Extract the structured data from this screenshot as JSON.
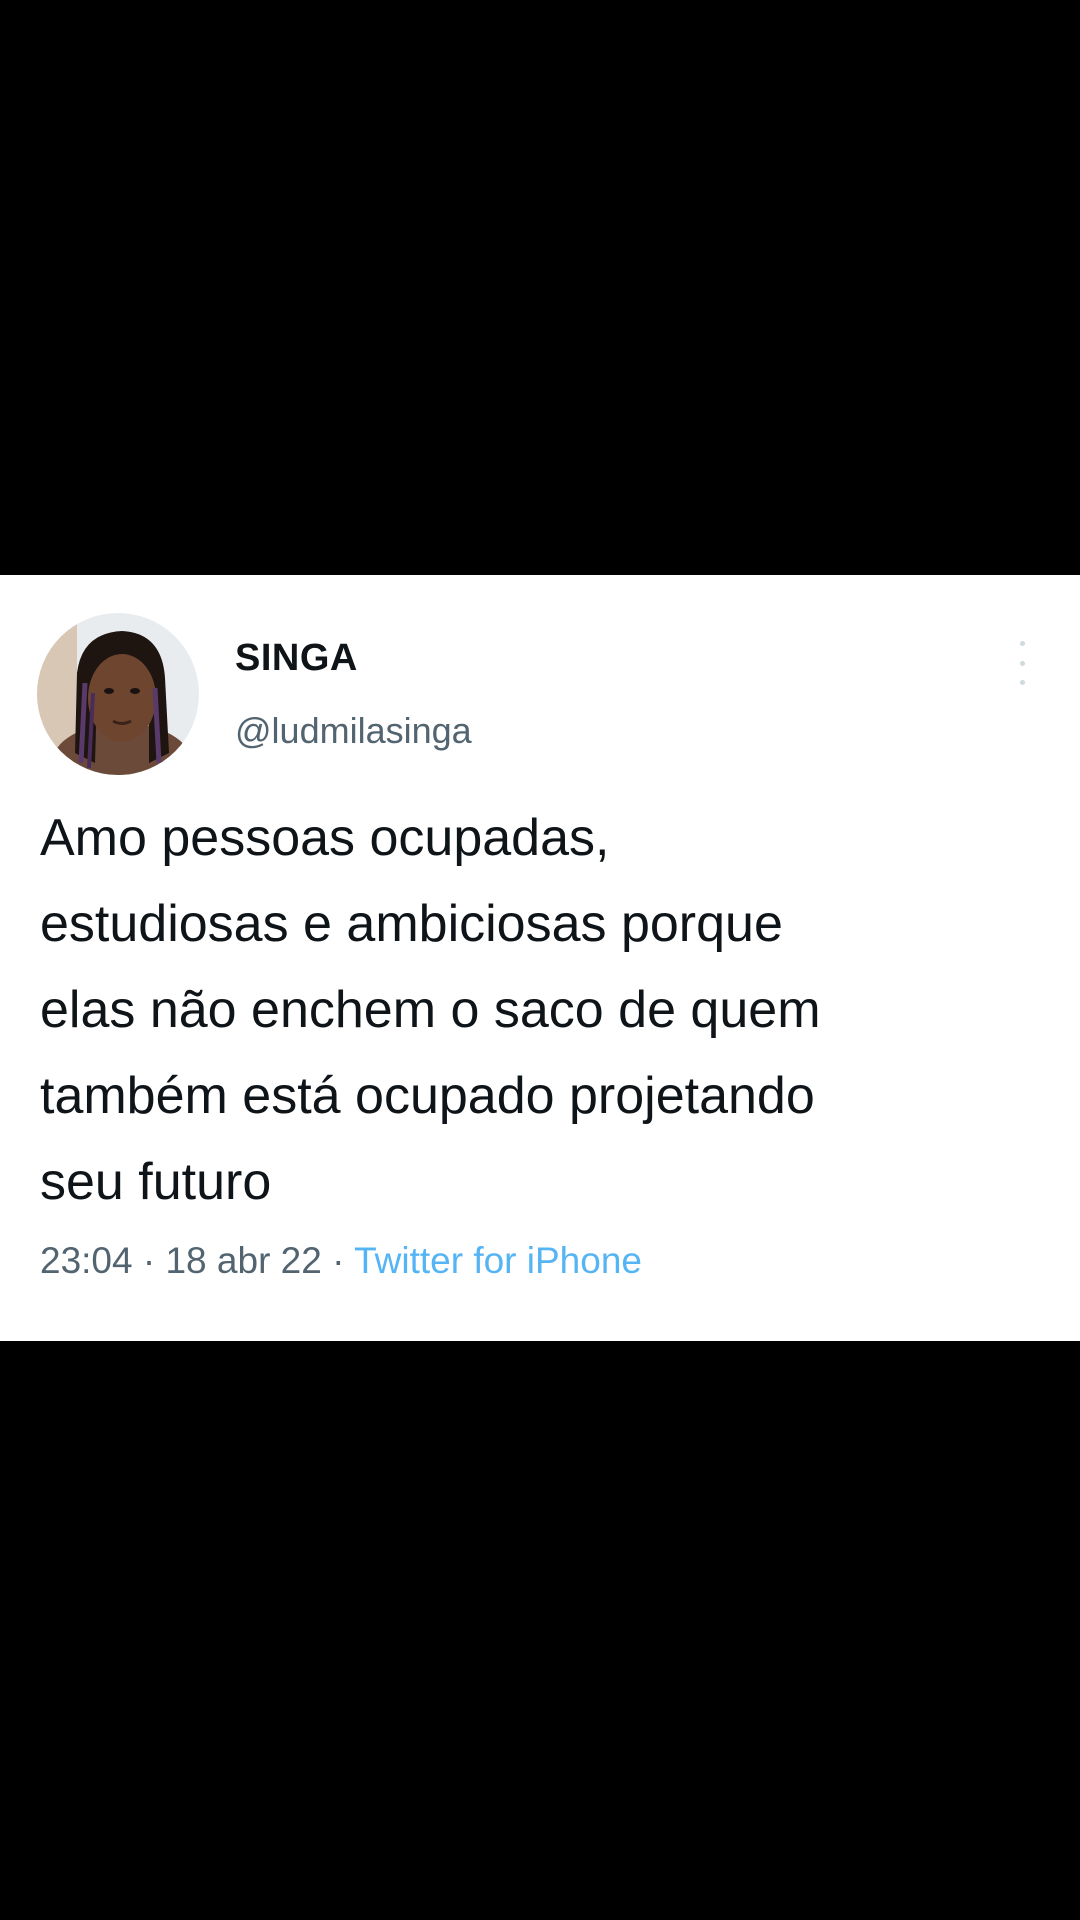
{
  "tweet": {
    "display_name": "SINGA",
    "handle": "@ludmilasinga",
    "text": "Amo pessoas ocupadas,\nestudiosas e ambiciosas porque\nelas não enchem o saco de quem\ntambém está ocupado projetando\nseu futuro",
    "time": "23:04",
    "separator": "·",
    "date": "18 abr 22",
    "source": "Twitter for iPhone"
  },
  "icons": {
    "more": "more-options-icon",
    "avatar": "avatar"
  },
  "colors": {
    "background": "#000000",
    "card": "#ffffff",
    "text": "#0f1419",
    "secondary": "#536471",
    "accent": "#1d9bf0"
  }
}
